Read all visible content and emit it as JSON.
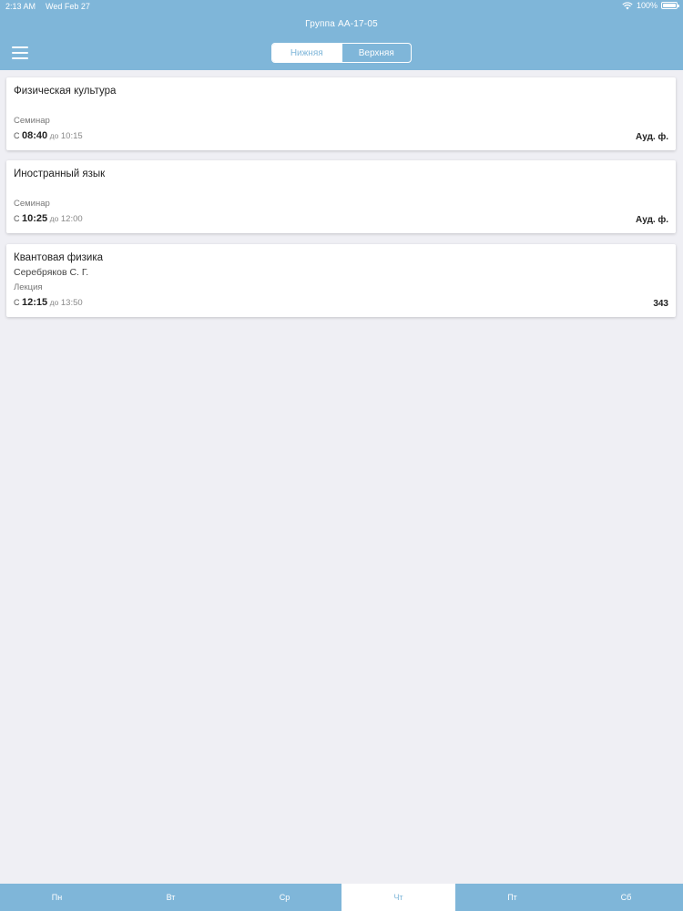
{
  "status": {
    "time": "2:13 AM",
    "date": "Wed Feb 27",
    "battery": "100%",
    "battery_level": 1.0
  },
  "header": {
    "title": "Группа АА-17-05",
    "week_tabs": [
      {
        "label": "Нижняя",
        "active": true
      },
      {
        "label": "Верхняя",
        "active": false
      }
    ]
  },
  "lessons": [
    {
      "title": "Физическая культура",
      "teacher": "",
      "type": "Семинар",
      "from_prefix": "С",
      "start": "08:40",
      "to_prefix": "до",
      "end": "10:15",
      "room": "Ауд. ф."
    },
    {
      "title": "Иностранный язык",
      "teacher": "",
      "type": "Семинар",
      "from_prefix": "С",
      "start": "10:25",
      "to_prefix": "до",
      "end": "12:00",
      "room": "Ауд. ф."
    },
    {
      "title": "Квантовая физика",
      "teacher": "Серебряков С. Г.",
      "type": "Лекция",
      "from_prefix": "С",
      "start": "12:15",
      "to_prefix": "до",
      "end": "13:50",
      "room": "343"
    }
  ],
  "days": [
    {
      "label": "Пн",
      "active": false
    },
    {
      "label": "Вт",
      "active": false
    },
    {
      "label": "Ср",
      "active": false
    },
    {
      "label": "Чт",
      "active": true
    },
    {
      "label": "Пт",
      "active": false
    },
    {
      "label": "Сб",
      "active": false
    }
  ],
  "colors": {
    "accent": "#7fb6d9",
    "background": "#efeff4",
    "card": "#ffffff"
  },
  "icons": {
    "menu": "hamburger-menu-icon",
    "wifi": "wifi-icon",
    "battery": "battery-icon"
  }
}
